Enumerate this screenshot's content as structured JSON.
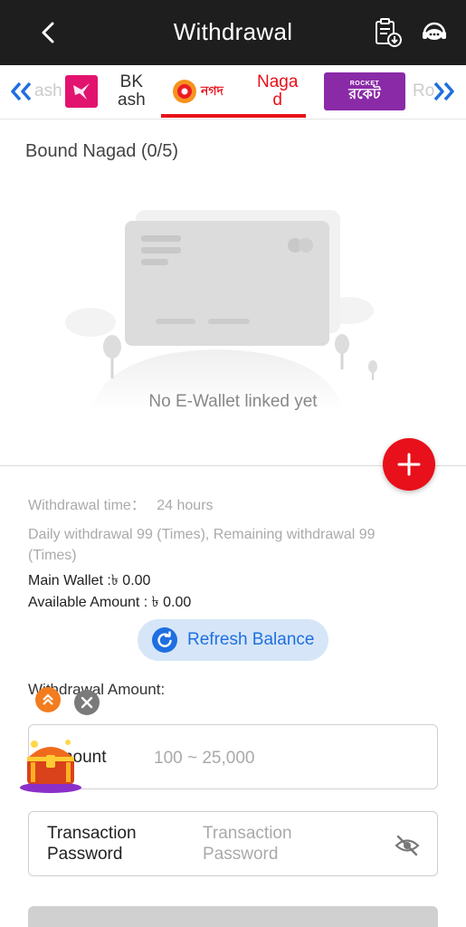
{
  "header": {
    "title": "Withdrawal",
    "back_icon": "chevron-left-icon",
    "record_icon": "clipboard-download-icon",
    "support_icon": "customer-service-icon"
  },
  "tabs": {
    "items": [
      {
        "label": "BK\nash",
        "partial_label": "ash",
        "logo": "bkash-logo",
        "active": false
      },
      {
        "label": "Naga\nd",
        "logo": "nagad-logo",
        "logo_text": "নগদ",
        "active": true
      },
      {
        "label": "Ro",
        "logo": "rocket-logo",
        "logo_text_top": "ROCKET",
        "logo_text_main": "রকেট",
        "active": false
      }
    ],
    "active_color": "#e8101a"
  },
  "bound": {
    "title": "Bound Nagad (0/5)",
    "empty_text": "No E-Wallet linked yet"
  },
  "info": {
    "withdrawal_time_label": "Withdrawal time：",
    "withdrawal_time_value": "24 hours",
    "daily_line1": "Daily withdrawal 99 (Times), Remaining withdrawal 99",
    "daily_line2": "(Times)",
    "main_wallet": "Main Wallet :৳ 0.00",
    "available_amount": "Available Amount : ৳ 0.00"
  },
  "refresh": {
    "label": "Refresh Balance"
  },
  "amount": {
    "section_label": "Withdrawal Amount:",
    "field_label": "Amount",
    "placeholder": "100 ~ 25,000"
  },
  "password": {
    "field_label": "Transaction\nPassword",
    "placeholder": "Transaction\nPassword"
  },
  "colors": {
    "header_bg": "#1e1e1e",
    "accent_red": "#e8101a",
    "accent_blue": "#1f6fe0",
    "refresh_bg": "#d6e6f8"
  }
}
